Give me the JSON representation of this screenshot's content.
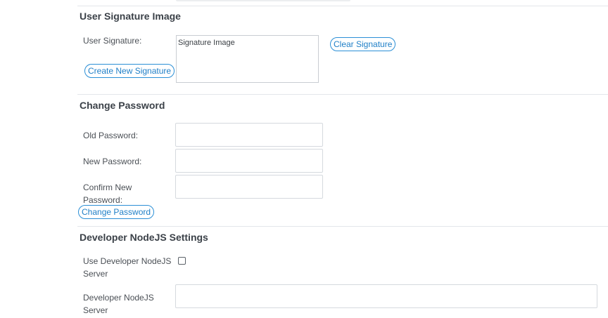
{
  "signature": {
    "title": "User Signature Image",
    "label": "User Signature:",
    "image_alt": "Signature Image",
    "clear_button": "Clear Signature",
    "create_button": "Create New Signature"
  },
  "password": {
    "title": "Change Password",
    "old_label": "Old Password:",
    "new_label": "New Password:",
    "confirm_label_line1": "Confirm New",
    "confirm_label_line2": "Password:",
    "old_value": "",
    "new_value": "",
    "confirm_value": "",
    "change_button": "Change Password"
  },
  "developer": {
    "title": "Developer NodeJS Settings",
    "use_label_line1": "Use Developer NodeJS",
    "use_label_line2": "Server",
    "use_checked": false,
    "server_label_line1": "Developer NodeJS",
    "server_label_line2": "Server",
    "server_value": ""
  },
  "colors": {
    "accent": "#1f7fc7",
    "divider": "#e3e6ea",
    "title_text": "#3b4148"
  }
}
